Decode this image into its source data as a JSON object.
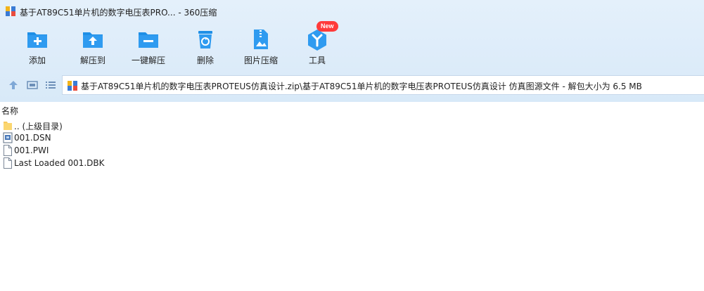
{
  "window": {
    "title": "基于AT89C51单片机的数字电压表PRO... - 360压缩"
  },
  "toolbar": {
    "items": [
      {
        "label": "添加",
        "icon": "add-folder-icon"
      },
      {
        "label": "解压到",
        "icon": "extract-to-icon"
      },
      {
        "label": "一键解压",
        "icon": "one-click-extract-icon"
      },
      {
        "label": "删除",
        "icon": "delete-icon"
      },
      {
        "label": "图片压缩",
        "icon": "image-compress-icon"
      },
      {
        "label": "工具",
        "icon": "tools-icon",
        "badge": "New"
      }
    ]
  },
  "navbar": {
    "path": "基于AT89C51单片机的数字电压表PROTEUS仿真设计.zip\\基于AT89C51单片机的数字电压表PROTEUS仿真设计 仿真图源文件 - 解包大小为 6.5 MB"
  },
  "list": {
    "column_name": "名称",
    "rows": [
      {
        "name": ".. (上级目录)",
        "icon": "parent-folder-icon"
      },
      {
        "name": "001.DSN",
        "icon": "dsn-file-icon"
      },
      {
        "name": "001.PWI",
        "icon": "file-icon"
      },
      {
        "name": "Last Loaded 001.DBK",
        "icon": "file-icon"
      }
    ]
  },
  "colors": {
    "toolbar_bg": "#dbeaf8",
    "icon_blue": "#1e90e6",
    "badge_red": "#ff3a3a"
  }
}
